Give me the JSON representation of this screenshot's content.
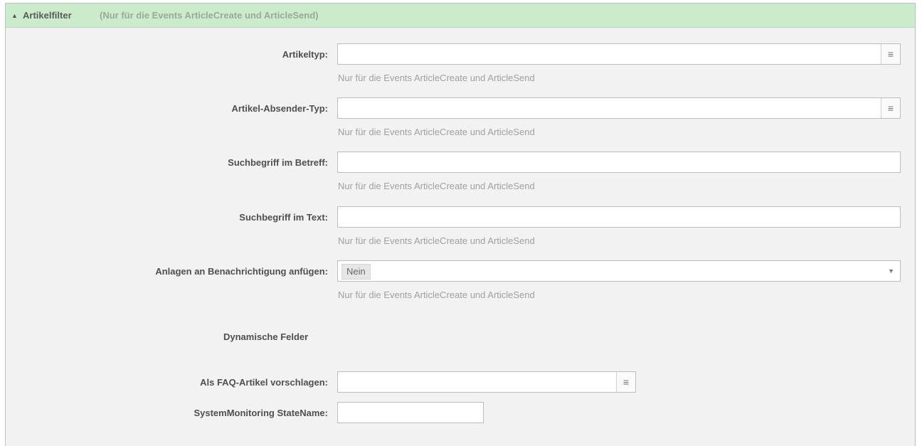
{
  "header": {
    "arrow_icon": "▲",
    "title": "Artikelfilter",
    "hint": "(Nur für die Events ArticleCreate und ArticleSend)"
  },
  "fields": {
    "article_type": {
      "label": "Artikeltyp:",
      "hint": "Nur für die Events ArticleCreate und ArticleSend",
      "icon": "list-icon"
    },
    "article_sender_type": {
      "label": "Artikel-Absender-Typ:",
      "hint": "Nur für die Events ArticleCreate und ArticleSend",
      "icon": "list-icon"
    },
    "subject_search": {
      "label": "Suchbegriff im Betreff:",
      "hint": "Nur für die Events ArticleCreate und ArticleSend",
      "value": ""
    },
    "body_search": {
      "label": "Suchbegriff im Text:",
      "hint": "Nur für die Events ArticleCreate und ArticleSend",
      "value": ""
    },
    "attachments": {
      "label": "Anlagen an Benachrichtigung anfügen:",
      "value": "Nein",
      "hint": "Nur für die Events ArticleCreate und ArticleSend"
    }
  },
  "dynamic_fields": {
    "section_title": "Dynamische Felder",
    "faq": {
      "label": "Als FAQ-Artikel vorschlagen:",
      "icon": "list-icon"
    },
    "system_monitoring": {
      "label": "SystemMonitoring StateName:",
      "value": ""
    }
  }
}
